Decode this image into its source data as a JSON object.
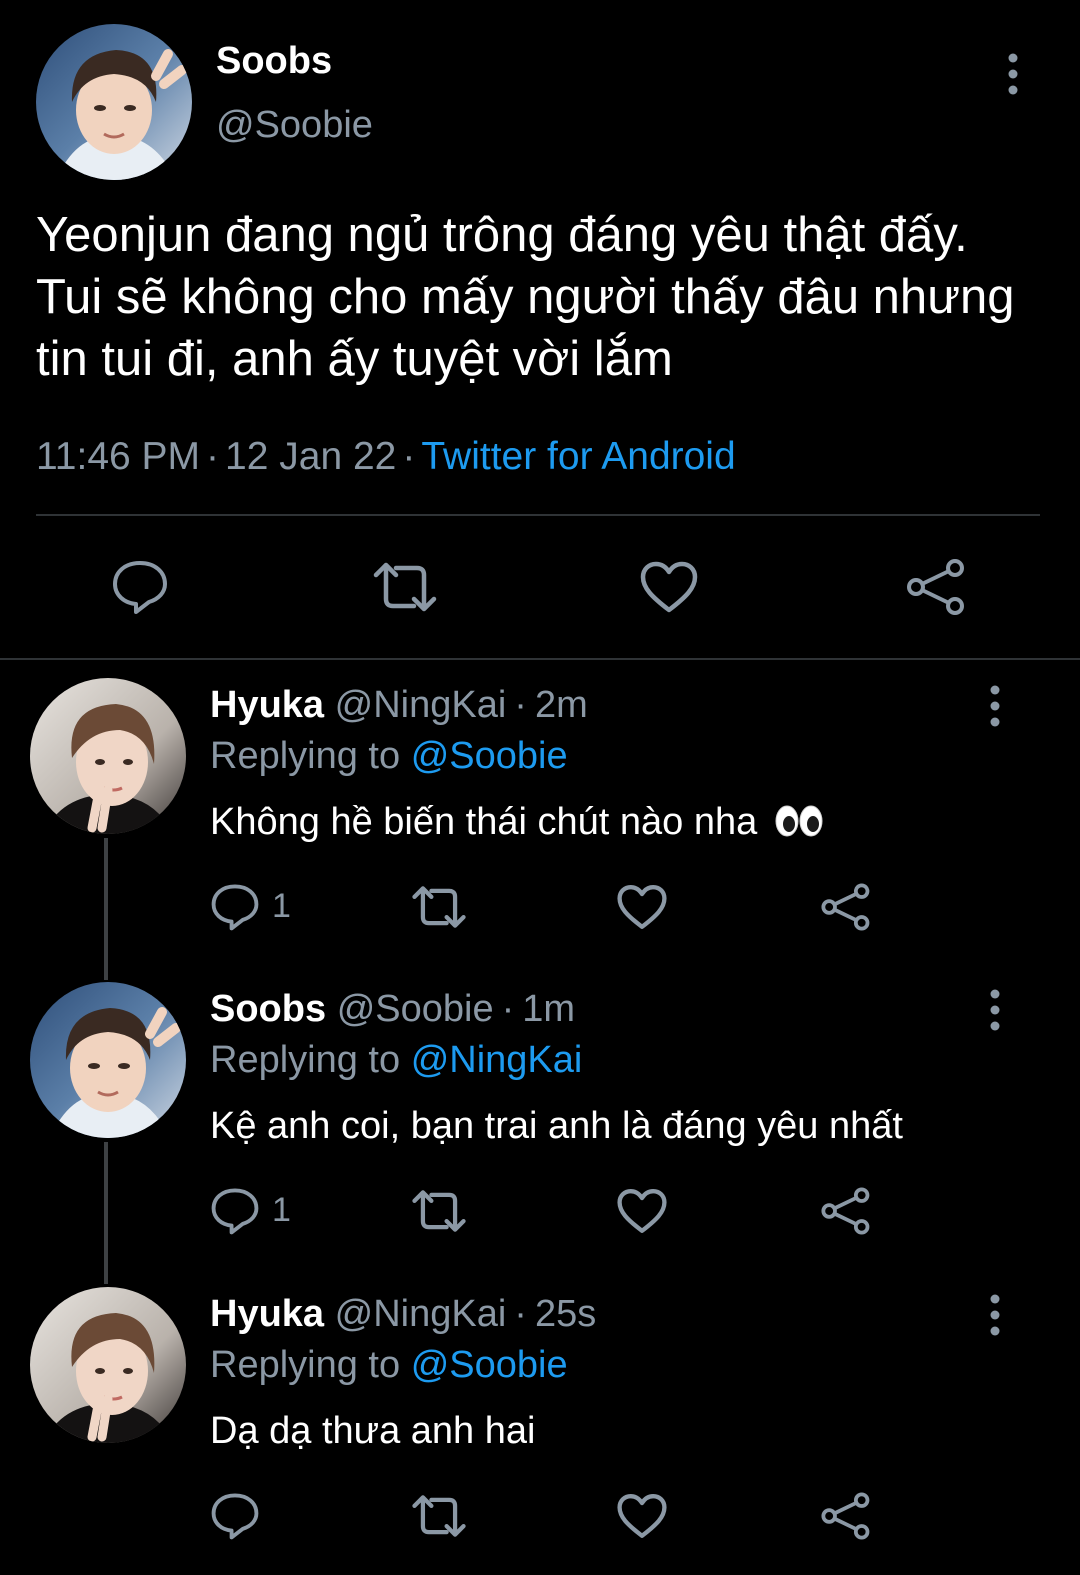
{
  "main_tweet": {
    "author_name": "Soobs",
    "author_handle": "@Soobie",
    "text": "Yeonjun đang ngủ trông đáng yêu thật đấy. Tui sẽ không cho mấy người thấy đâu nhưng tin tui đi, anh ấy tuyệt vời lắm",
    "time": "11:46 PM",
    "separator": "·",
    "date": "12 Jan 22",
    "source": "Twitter for Android",
    "icons": [
      "avatar",
      "more-vertical-icon",
      "reply-icon",
      "retweet-icon",
      "like-icon",
      "share-icon"
    ]
  },
  "replies": [
    {
      "author_name": "Hyuka",
      "author_handle": "@NingKai",
      "time": "2m",
      "separator": "·",
      "replying_prefix": "Replying to",
      "replying_to": "@Soobie",
      "text": "Không hề biến thái chút nào nha",
      "emoji": "👀",
      "reply_count": "1"
    },
    {
      "author_name": "Soobs",
      "author_handle": "@Soobie",
      "time": "1m",
      "separator": "·",
      "replying_prefix": "Replying to",
      "replying_to": "@NingKai",
      "text": "Kệ anh coi, bạn trai anh là đáng yêu nhất",
      "reply_count": "1"
    },
    {
      "author_name": "Hyuka",
      "author_handle": "@NingKai",
      "time": "25s",
      "separator": "·",
      "replying_prefix": "Replying to",
      "replying_to": "@Soobie",
      "text": "Dạ dạ thưa anh hai",
      "reply_count": ""
    }
  ],
  "colors": {
    "background": "#000000",
    "text_primary": "#ffffff",
    "text_secondary": "#8b98a5",
    "accent": "#1d9bf0",
    "divider": "#2f3336"
  }
}
